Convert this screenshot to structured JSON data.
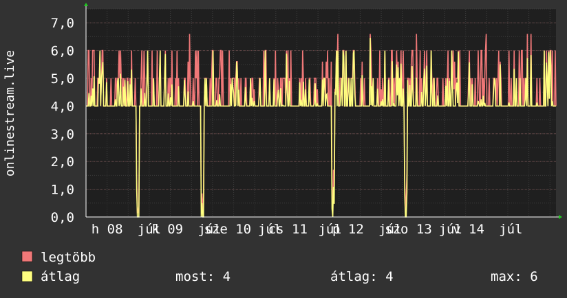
{
  "chart_data": {
    "type": "line",
    "ylabel": "onlinestream.live",
    "ylim": [
      0,
      7.5
    ],
    "yticks": [
      "0,0",
      "1,0",
      "2,0",
      "3,0",
      "4,0",
      "5,0",
      "6,0",
      "7,0"
    ],
    "ytick_values": [
      0,
      1,
      2,
      3,
      4,
      5,
      6,
      7
    ],
    "xlim": [
      0,
      7.8
    ],
    "xticks": [
      "h 08",
      "júl",
      "k 09",
      "júl",
      "sze 10",
      "júl",
      "cs 11",
      "júl",
      "p 12",
      "júl",
      "szo 13",
      "júl",
      "v 14",
      "júl"
    ],
    "xtick_positions": [
      0.35,
      1.05,
      1.35,
      2.05,
      2.35,
      3.05,
      3.35,
      4.05,
      4.35,
      5.05,
      5.35,
      6.05,
      6.35,
      7.05
    ],
    "grid": true,
    "series": [
      {
        "name": "legtöbb",
        "color": "#f07878"
      },
      {
        "name": "átlag",
        "color": "#ffff80"
      }
    ],
    "legend_position": "bottom-left",
    "stats": {
      "most": "most: 4",
      "atlag": "átlag: 4",
      "max": "max: 6"
    }
  }
}
